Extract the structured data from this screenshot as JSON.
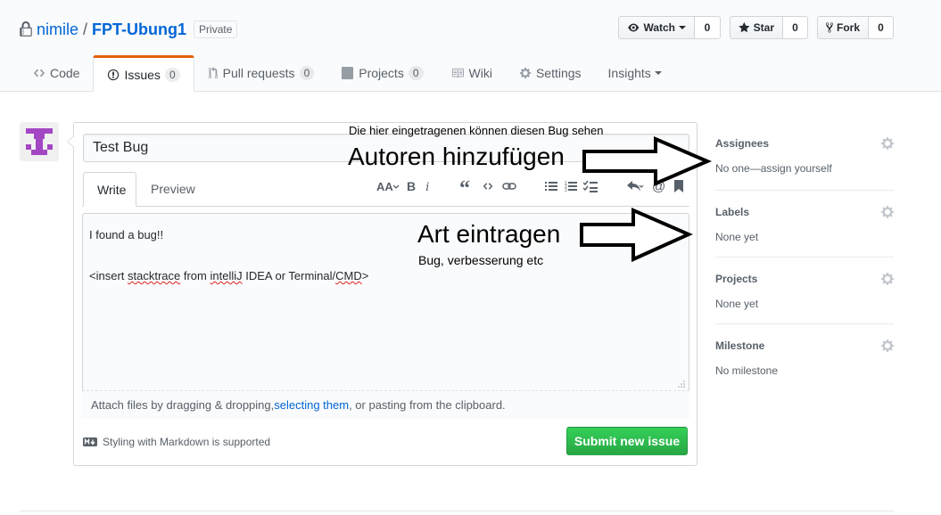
{
  "repo": {
    "owner": "nimile",
    "separator": "/",
    "name": "FPT-Ubung1",
    "visibility": "Private"
  },
  "actions": {
    "watch": {
      "label": "Watch",
      "count": "0"
    },
    "star": {
      "label": "Star",
      "count": "0"
    },
    "fork": {
      "label": "Fork",
      "count": "0"
    }
  },
  "nav": {
    "code": "Code",
    "issues": {
      "label": "Issues",
      "count": "0"
    },
    "pulls": {
      "label": "Pull requests",
      "count": "0"
    },
    "projects": {
      "label": "Projects",
      "count": "0"
    },
    "wiki": "Wiki",
    "settings": "Settings",
    "insights": "Insights"
  },
  "issue_form": {
    "title_value": "Test Bug",
    "tabs": {
      "write": "Write",
      "preview": "Preview"
    },
    "body_lines": [
      "I found a bug!!"
    ],
    "body_line2": {
      "a": "<insert ",
      "b": "stacktrace",
      "c": " from ",
      "d": "intelliJ",
      "e": " IDEA or Terminal/",
      "f": "CMD",
      "g": ">"
    },
    "attach": {
      "prefix": "Attach files by dragging & dropping, ",
      "link": "selecting them",
      "suffix": ", or pasting from the clipboard."
    },
    "markdown_note": "Styling with Markdown is supported",
    "submit": "Submit new issue"
  },
  "sidebar": {
    "assignees": {
      "heading": "Assignees",
      "value": "No one—assign yourself"
    },
    "labels": {
      "heading": "Labels",
      "value": "None yet"
    },
    "projects": {
      "heading": "Projects",
      "value": "None yet"
    },
    "milestone": {
      "heading": "Milestone",
      "value": "No milestone"
    }
  },
  "annotations": {
    "small_note": "Die hier eingetragenen können diesen Bug sehen",
    "authors": "Autoren hinzufügen",
    "type": "Art eintragen",
    "type_note": "Bug, verbesserung etc"
  },
  "colors": {
    "link": "#0366d6",
    "nav_accent": "#e36209",
    "submit_green": "#28a745",
    "avatar": "#a347c4"
  }
}
